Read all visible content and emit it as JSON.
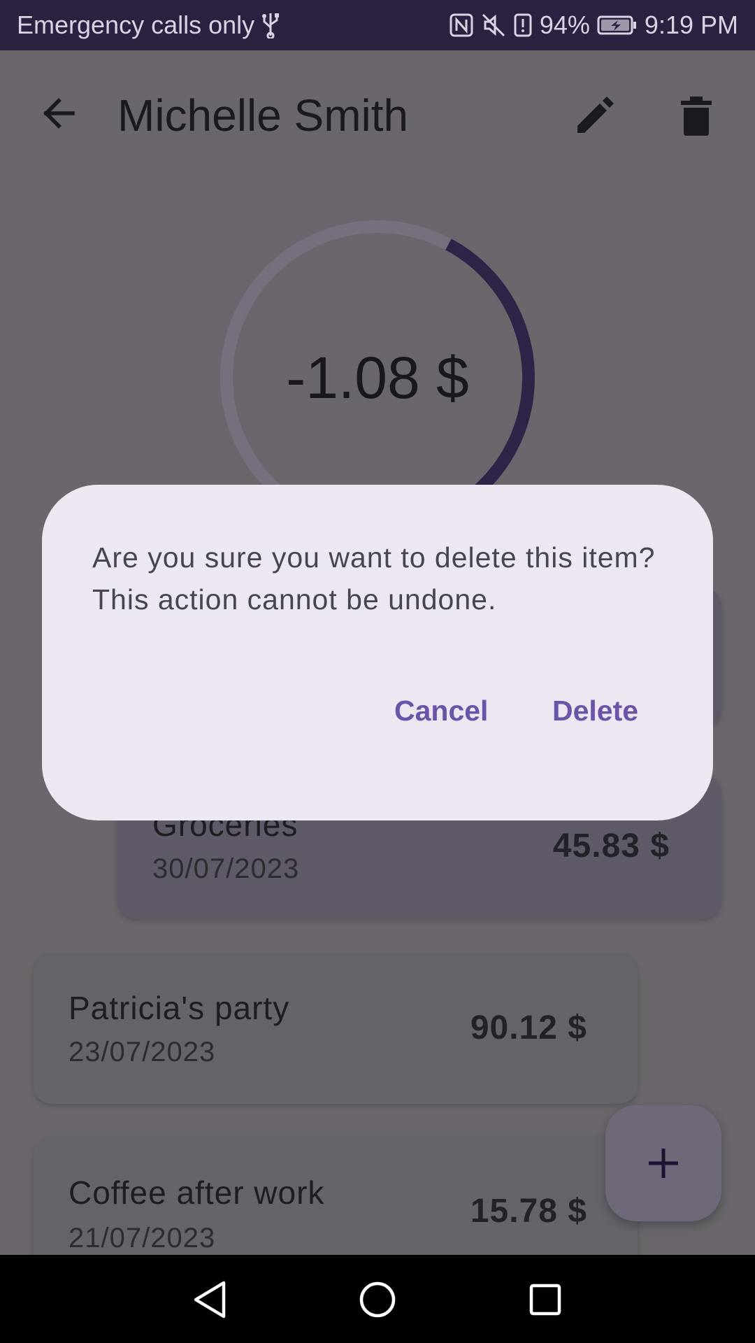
{
  "status_bar": {
    "carrier_text": "Emergency calls only",
    "battery_percent": "94%",
    "time": "9:19 PM",
    "icons": [
      "usb-icon",
      "nfc-icon",
      "mute-icon",
      "battery-alert-icon",
      "battery-charging-icon"
    ]
  },
  "app_bar": {
    "title": "Michelle Smith",
    "icons": [
      "arrow-back-icon",
      "pencil-icon",
      "trash-icon"
    ]
  },
  "balance": {
    "value": "-1.08 $",
    "ring_progress_fraction": 0.45
  },
  "transactions": [
    {
      "title": "Groceries",
      "date": "30/07/2023",
      "amount": "45.83 $"
    },
    {
      "title": "Patricia's party",
      "date": "23/07/2023",
      "amount": "90.12 $"
    },
    {
      "title": "Coffee after work",
      "date": "21/07/2023",
      "amount": "15.78 $"
    }
  ],
  "fab": {
    "icon": "plus-icon"
  },
  "dialog": {
    "message": "Are you sure you want to delete this item? This action cannot be undone.",
    "cancel_label": "Cancel",
    "delete_label": "Delete"
  },
  "colors": {
    "status_bar_bg": "#2d2142",
    "scrim": "#6a666b",
    "dialog_bg": "#ede7f2",
    "accent": "#6a54a8",
    "ring_track": "#76707e",
    "ring_progress": "#2f2347"
  },
  "nav_bar": {
    "icons": [
      "nav-back-icon",
      "nav-home-icon",
      "nav-recents-icon"
    ]
  }
}
